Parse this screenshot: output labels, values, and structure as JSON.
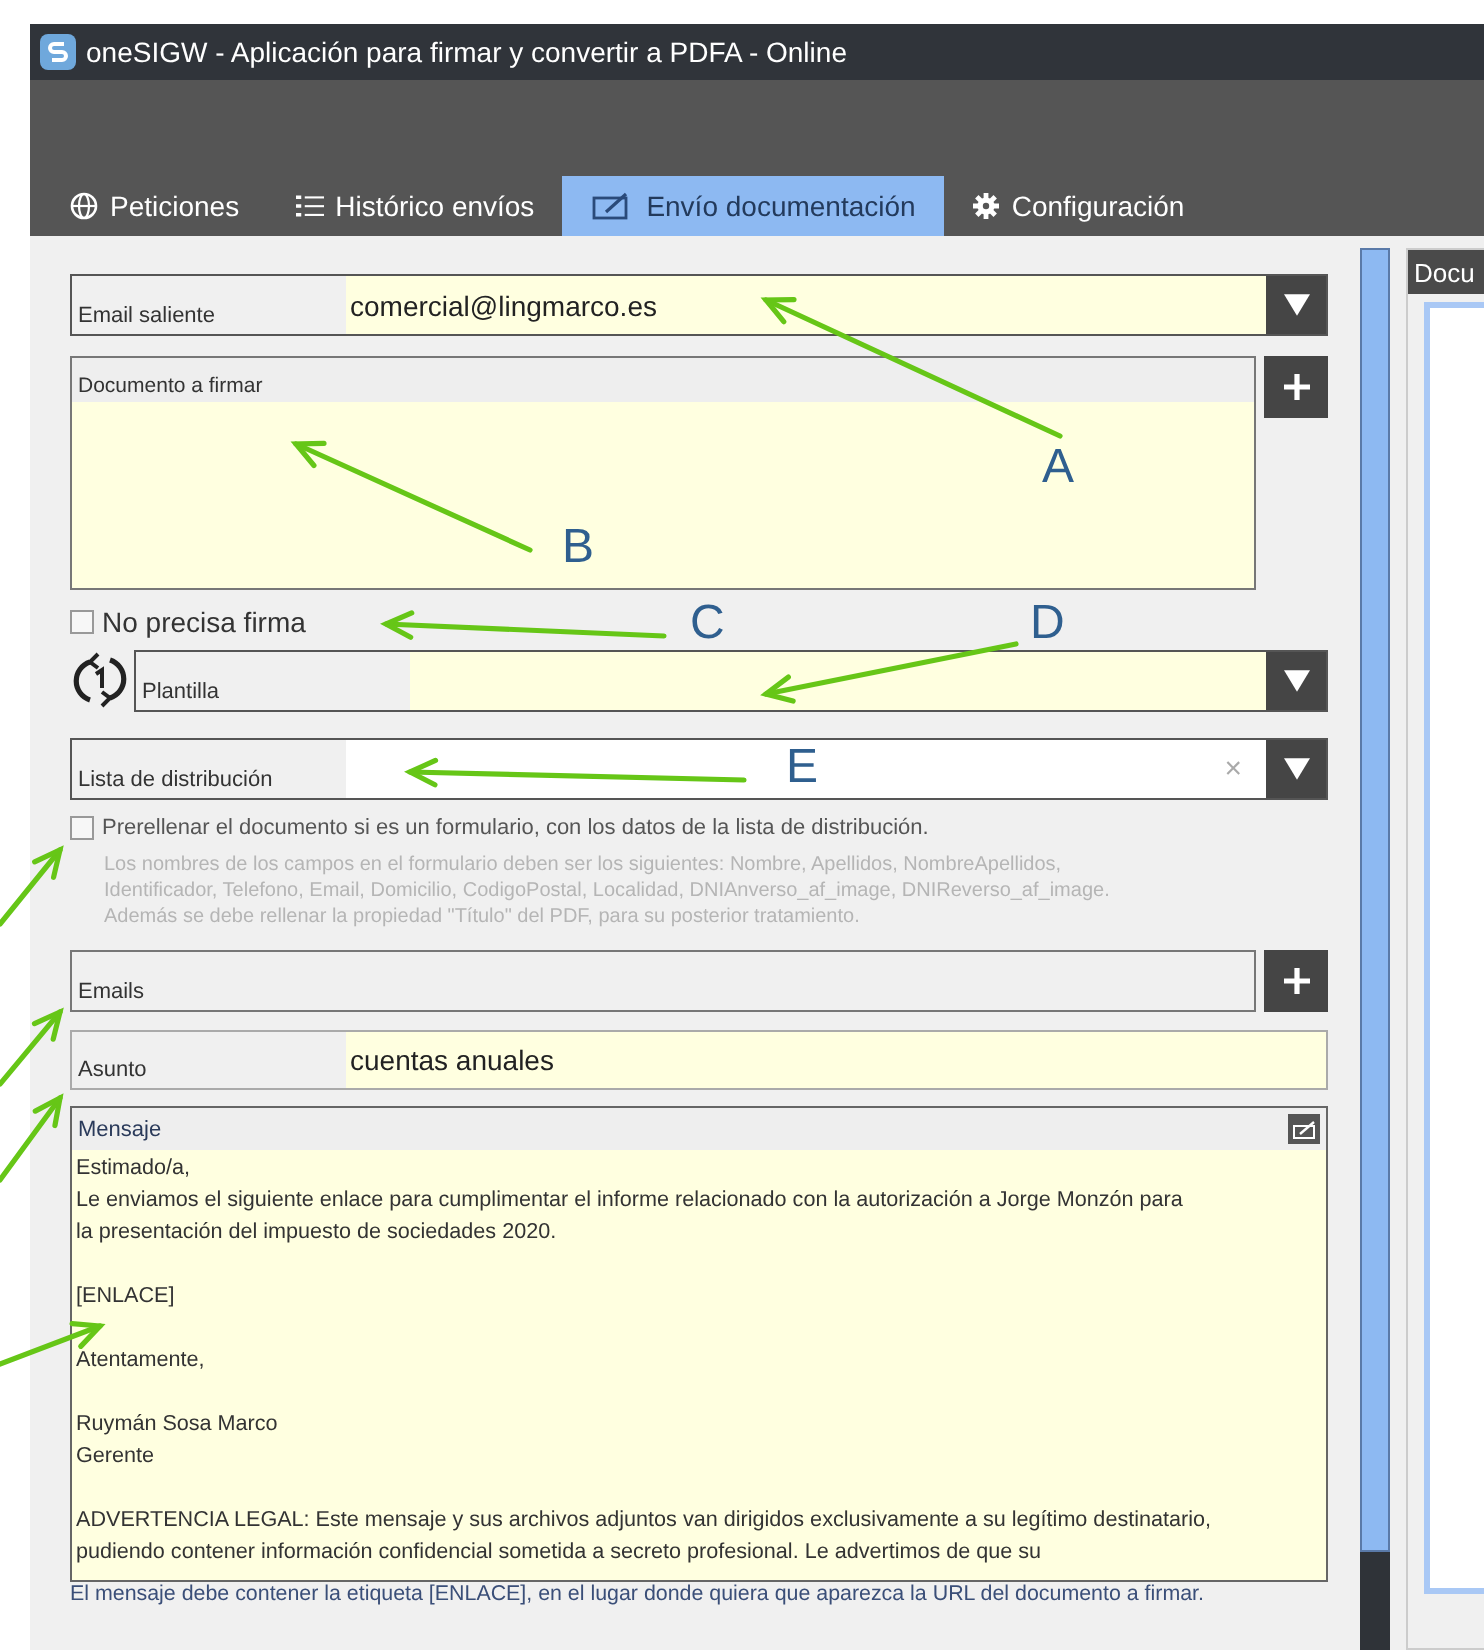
{
  "window": {
    "title": "oneSIGW - Aplicación para firmar y convertir a PDFA - Online"
  },
  "tabs": [
    {
      "label": "Peticiones",
      "kind": "globe",
      "selected": false
    },
    {
      "label": "Histórico envíos",
      "kind": "list",
      "selected": false
    },
    {
      "label": "Envío documentación",
      "kind": "edit",
      "selected": true
    },
    {
      "label": "Configuración",
      "kind": "gear",
      "selected": false
    }
  ],
  "form": {
    "sender": {
      "label": "Email saliente",
      "value": "comercial@lingmarco.es"
    },
    "document": {
      "label": "Documento a firmar"
    },
    "no_signature": {
      "label": "No precisa firma",
      "checked": false
    },
    "template": {
      "label": "Plantilla"
    },
    "distribution_list": {
      "label": "Lista de distribución",
      "clear": "×"
    },
    "prefill": {
      "label": "Prerellenar el documento si es un formulario, con los datos de la lista de distribución.",
      "checked": false,
      "hint": [
        "Los nombres de los campos en el formulario deben ser los siguientes: Nombre, Apellidos, NombreApellidos,",
        "Identificador, Telefono, Email, Domicilio, CodigoPostal, Localidad, DNIAnverso_af_image, DNIReverso_af_image.",
        "Además se debe rellenar la propiedad \"Título\" del PDF, para su posterior tratamiento."
      ]
    },
    "emails": {
      "label": "Emails"
    },
    "subject": {
      "label": "Asunto",
      "value": "cuentas anuales"
    },
    "message": {
      "label": "Mensaje",
      "paragraphs": [
        [
          "Estimado/a,",
          "Le enviamos el siguiente enlace para cumplimentar el informe relacionado con la autorización a Jorge Monzón para",
          "la presentación del impuesto de sociedades 2020."
        ],
        [
          "[ENLACE]"
        ],
        [
          "Atentamente,"
        ],
        [
          "Ruymán Sosa Marco",
          "Gerente"
        ],
        [
          "ADVERTENCIA LEGAL: Este mensaje y sus archivos adjuntos van dirigidos exclusivamente a su legítimo destinatario,",
          "pudiendo contener información confidencial sometida a secreto profesional. Le advertimos de que su"
        ]
      ]
    },
    "note": "El mensaje debe contener la etiqueta [ENLACE], en el lugar donde quiera que aparezca la URL del documento a firmar."
  },
  "side_panel": {
    "title": "Docu"
  },
  "annotations": [
    {
      "label": "A"
    },
    {
      "label": "B"
    },
    {
      "label": "C"
    },
    {
      "label": "D"
    },
    {
      "label": "E"
    }
  ]
}
